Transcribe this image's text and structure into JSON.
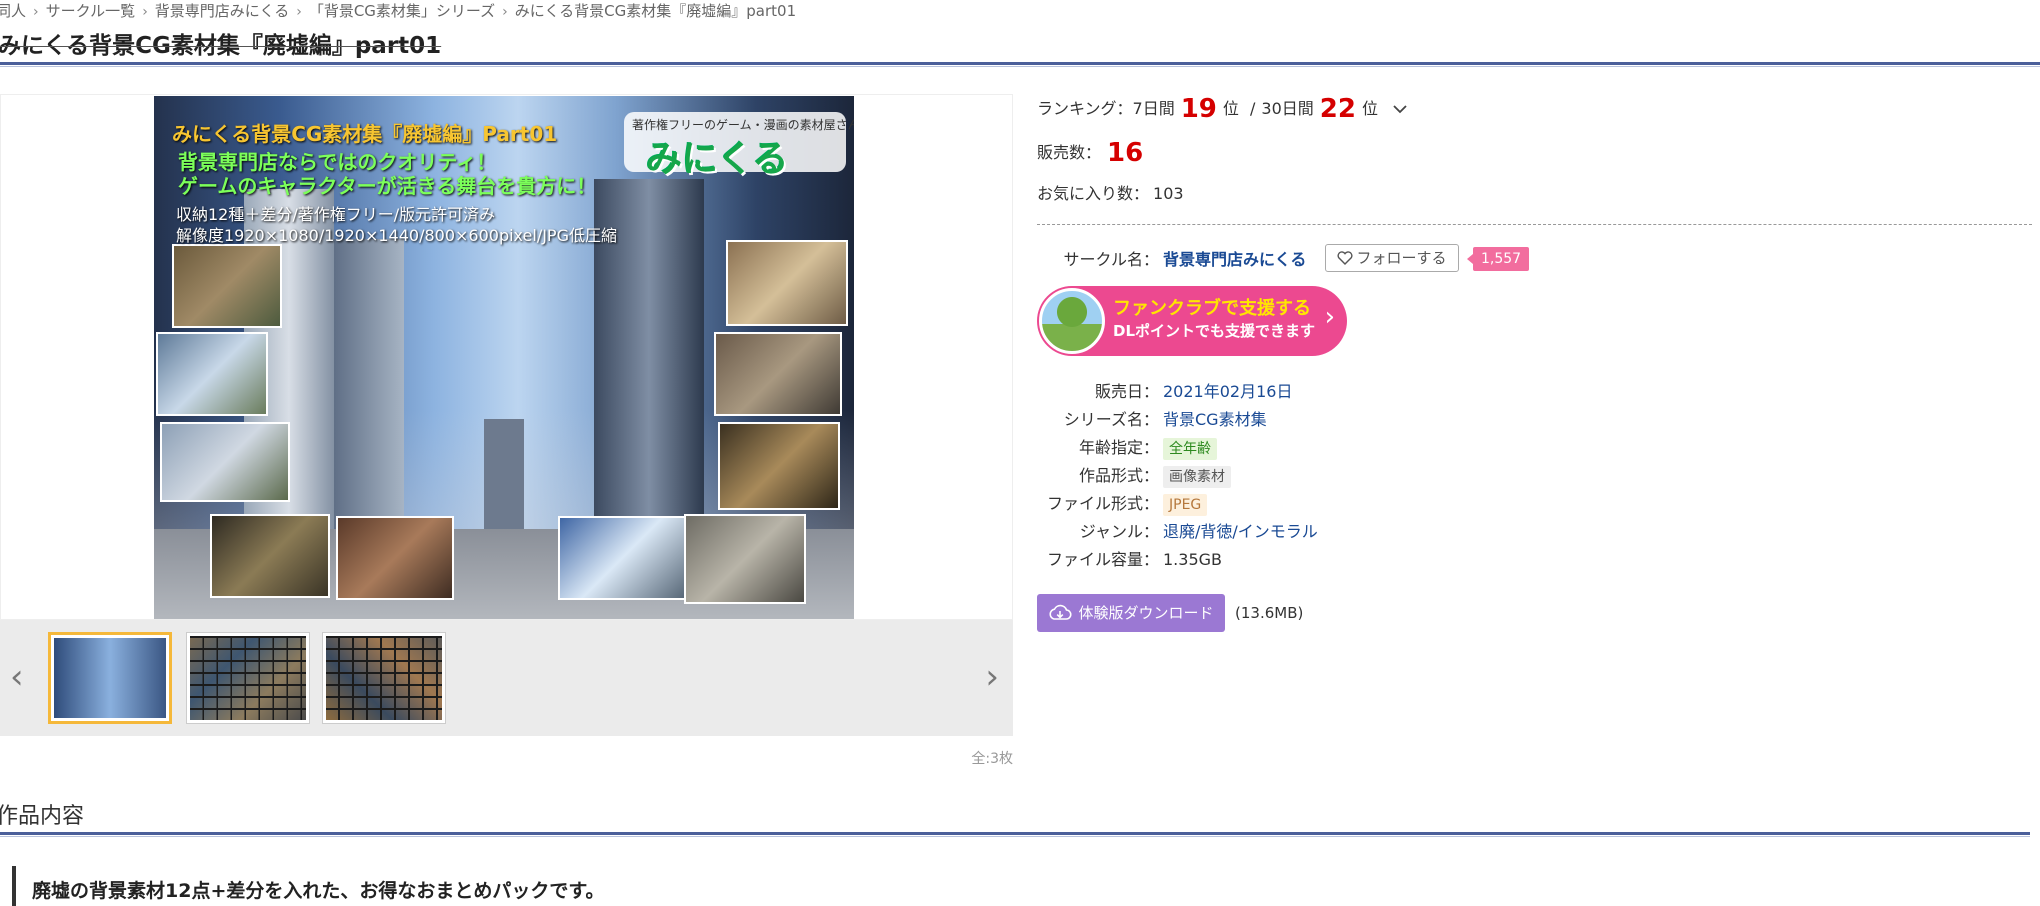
{
  "breadcrumb": [
    "同人",
    "サークル一覧",
    "背景専門店みにくる",
    "「背景CG素材集」シリーズ",
    "みにくる背景CG素材集『廃墟編』part01"
  ],
  "title": "みにくる背景CG素材集『廃墟編』part01",
  "main_image": {
    "line1": "みにくる背景CG素材集『廃墟編』Part01",
    "line2": "背景専門店ならではのクオリティ！",
    "line3": "ゲームのキャラクターが活きる舞台を貴方に！",
    "line4": "収納12種＋差分/著作権フリー/版元許可済み",
    "line5": "解像度1920×1080/1920×1440/800×600pixel/JPG低圧縮",
    "badge_sub": "著作権フリーのゲーム・漫画の素材屋さん",
    "badge_logo": "みにくる"
  },
  "gallery": {
    "count_label": "全:3枚",
    "prev_icon": "‹",
    "next_icon": "›"
  },
  "ranking": {
    "label": "ランキング：",
    "week_label": "7日間",
    "week_rank": "19",
    "month_label": "30日間",
    "month_rank": "22",
    "unit": "位",
    "slash": "/"
  },
  "sales": {
    "label": "販売数：",
    "value": "16"
  },
  "favorites": {
    "label": "お気に入り数：",
    "value": "103"
  },
  "circle": {
    "label": "サークル名：",
    "name": "背景専門店みにくる",
    "follow_label": "フォローする",
    "follow_count": "1,557"
  },
  "fanclub": {
    "title": "ファンクラブで支援する",
    "sub": "DLポイントでも支援できます"
  },
  "details": {
    "release_label": "販売日：",
    "release_value": "2021年02月16日",
    "series_label": "シリーズ名：",
    "series_value": "背景CG素材集",
    "age_label": "年齢指定：",
    "age_value": "全年齢",
    "type_label": "作品形式：",
    "type_value": "画像素材",
    "format_label": "ファイル形式：",
    "format_value": "JPEG",
    "genre_label": "ジャンル：",
    "genre_value": "退廃/背徳/インモラル",
    "size_label": "ファイル容量：",
    "size_value": "1.35GB"
  },
  "download": {
    "label": "体験版ダウンロード",
    "size": "(13.6MB)"
  },
  "description": {
    "section_title": "作品内容",
    "text": "廃墟の背景素材12点+差分を入れた、お得なおまとめパックです。"
  },
  "colors": {
    "accent_red": "#d50000",
    "link": "#1a4a94",
    "fanclub_pink": "#ec4990",
    "download_purple": "#9b78d3",
    "rule": "#4b5f9a"
  }
}
